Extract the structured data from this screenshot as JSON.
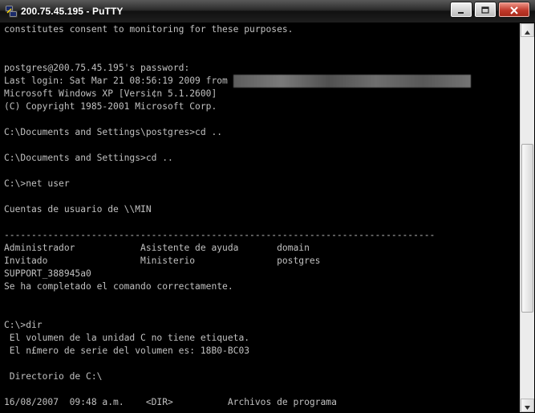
{
  "window": {
    "title": "200.75.45.195 - PuTTY",
    "icon": "putty-icon",
    "buttons": [
      "minimize-icon",
      "maximize-icon",
      "close-icon"
    ]
  },
  "terminal": {
    "lines": [
      "constitutes consent to monitoring for these purposes.",
      "",
      "",
      "postgres@200.75.45.195's password:",
      "Last login: Sat Mar 21 08:56:19 2009 from ",
      "Microsoft Windows XP [Versi¢n 5.1.2600]",
      "(C) Copyright 1985-2001 Microsoft Corp.",
      "",
      "C:\\Documents and Settings\\postgres>cd ..",
      "",
      "C:\\Documents and Settings>cd ..",
      "",
      "C:\\>net user",
      "",
      "Cuentas de usuario de \\\\MIN",
      "",
      "-------------------------------------------------------------------------------",
      "Administrador            Asistente de ayuda       domain",
      "Invitado                 Ministerio               postgres",
      "SUPPORT_388945a0",
      "Se ha completado el comando correctamente.",
      "",
      "",
      "C:\\>dir",
      " El volumen de la unidad C no tiene etiqueta.",
      " El n£mero de serie del volumen es: 18B0-BC03",
      "",
      " Directorio de C:\\",
      "",
      "16/08/2007  09:48 a.m.    <DIR>          Archivos de programa"
    ]
  },
  "colors": {
    "background": "#000000",
    "text": "#c0c0c0"
  }
}
